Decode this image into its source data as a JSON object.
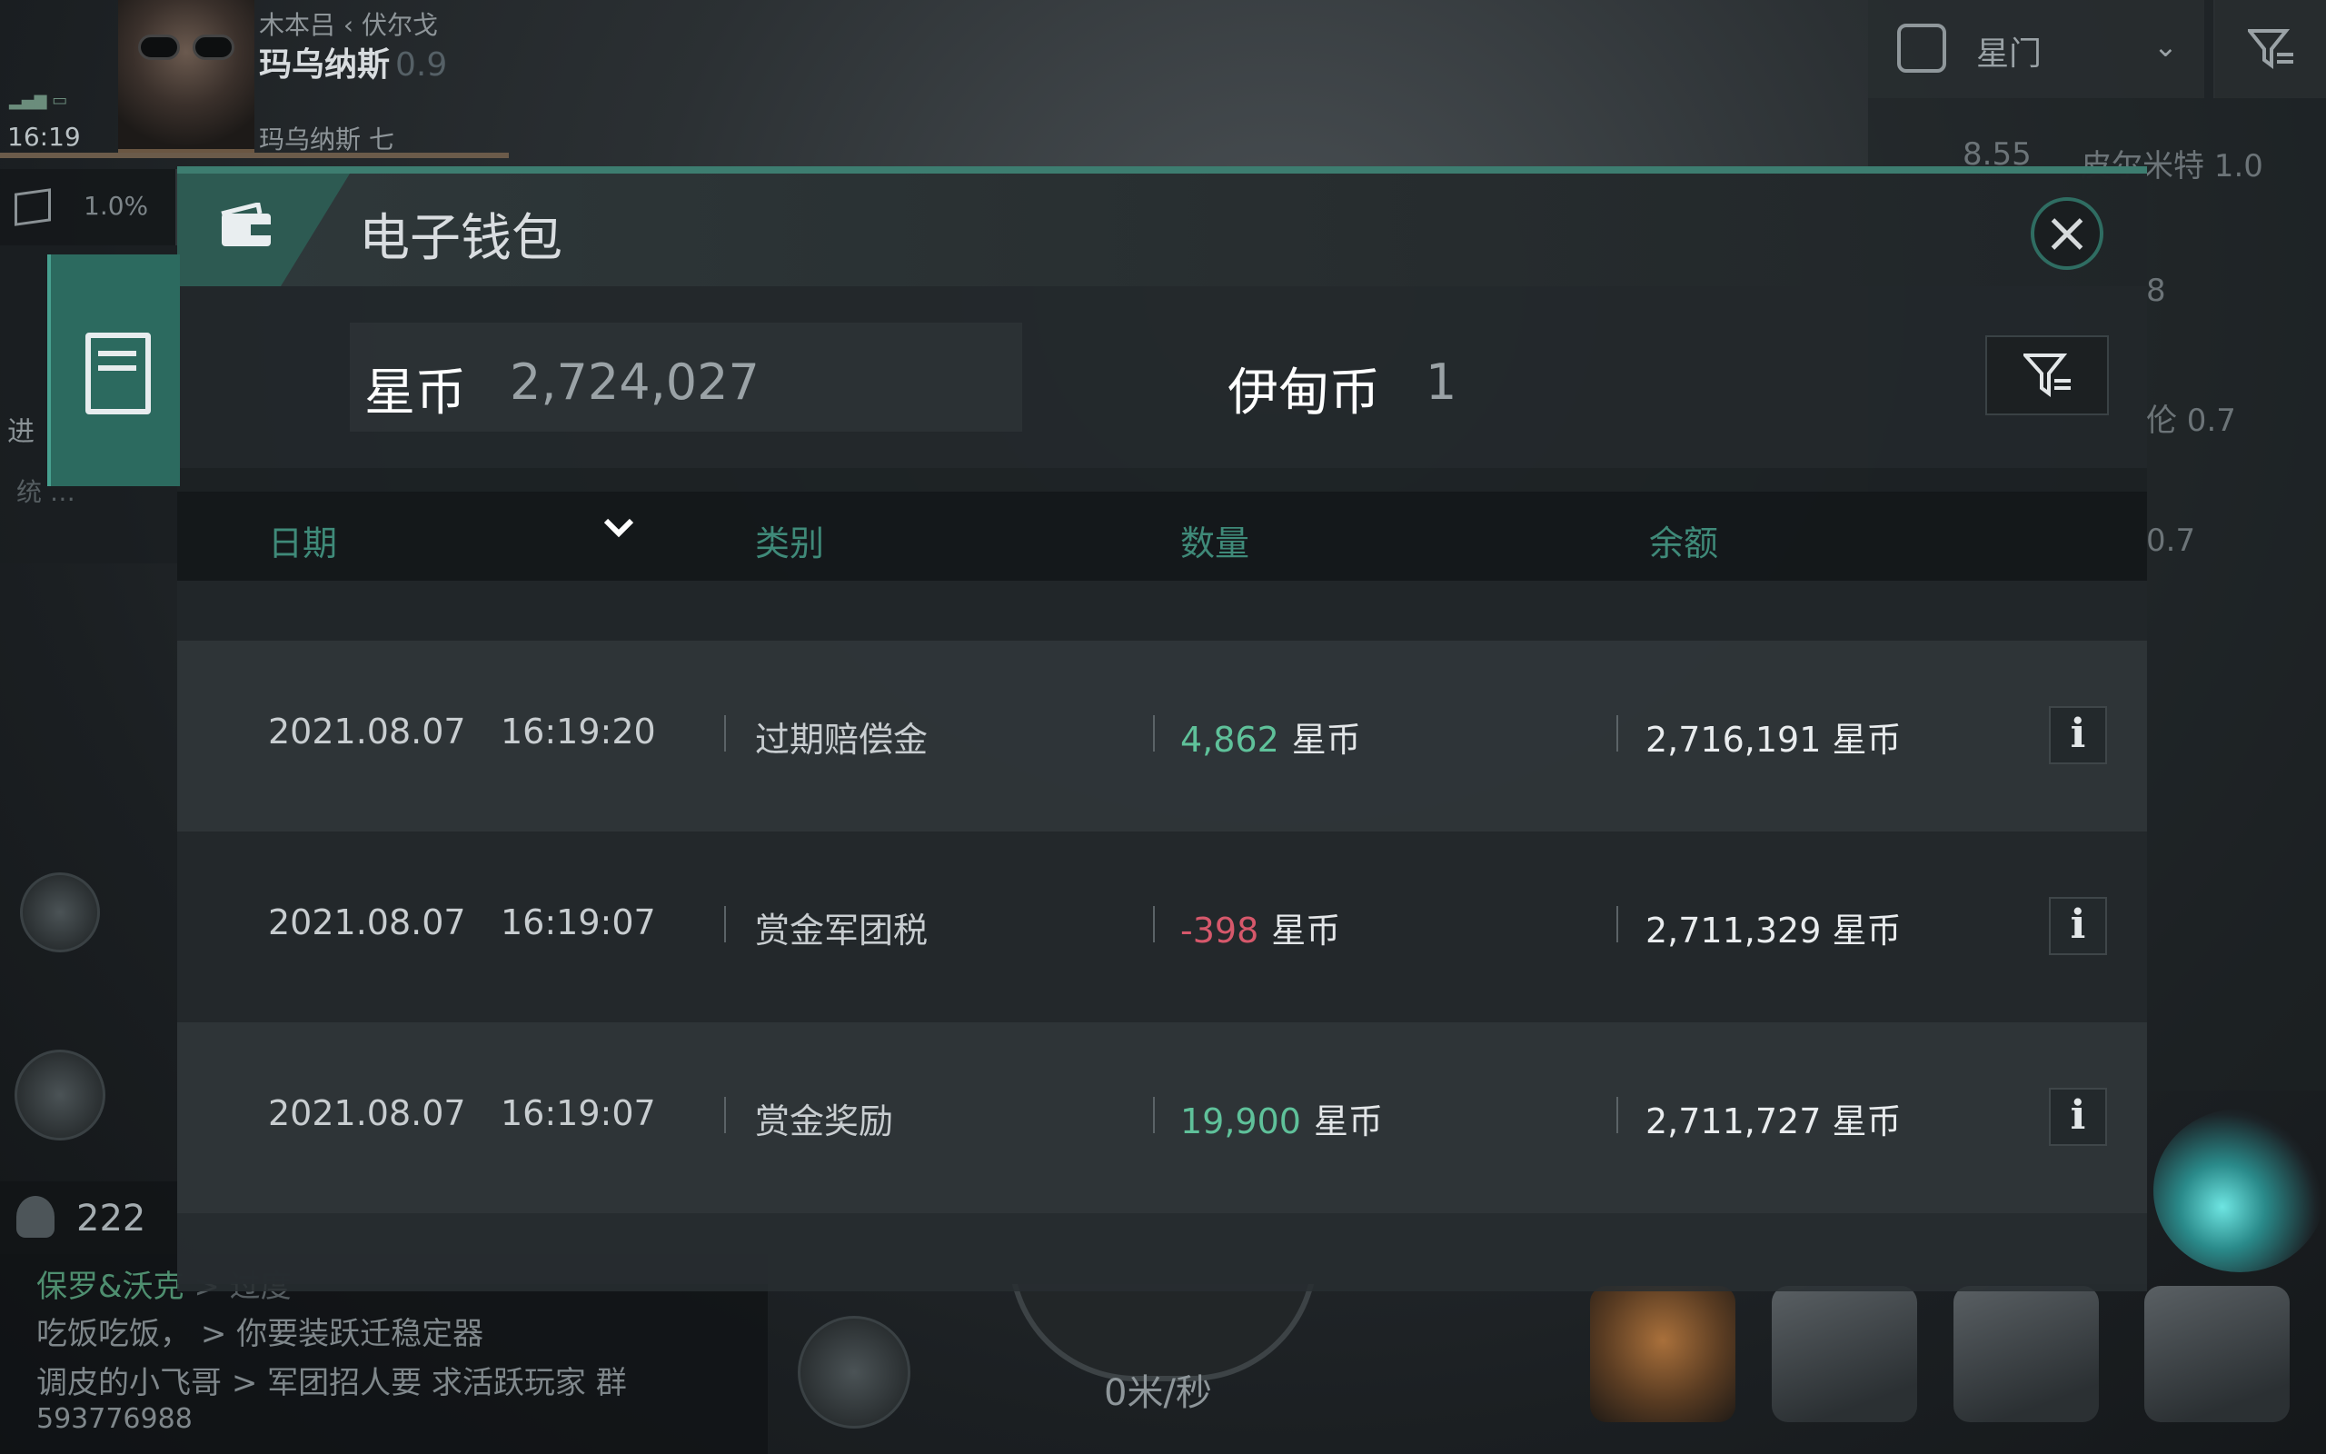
{
  "hud": {
    "time": "16:19",
    "route": "木本吕 ‹ 伏尔戈",
    "system": "玛乌纳斯",
    "security": "0.9",
    "station": "玛乌纳斯 七",
    "cargo_pct": "1.0%",
    "side_text_1": "进",
    "side_text_2": "统 …",
    "gate_label": "星门",
    "right_rows": [
      "8.55",
      "皮尔米特 1.0",
      "8",
      "伦 0.7",
      "0.7"
    ],
    "local_count": "222",
    "speed": "0米/秒"
  },
  "chat": {
    "lines": [
      {
        "name": "保罗&沃克",
        "text": "> 过度"
      },
      {
        "name": "吃饭吃饭，",
        "text": "> 你要装跃迁稳定器"
      },
      {
        "name": "调皮的小飞哥",
        "text": "> 军团招人要 求活跃玩家 群"
      },
      {
        "name": "",
        "text": "593776988"
      }
    ]
  },
  "wallet": {
    "title": "电子钱包",
    "star_coin_label": "星币",
    "star_coin_value": "2,724,027",
    "eden_coin_label": "伊甸币",
    "eden_coin_value": "1",
    "columns": {
      "date": "日期",
      "category": "类别",
      "amount": "数量",
      "balance": "余额"
    },
    "rows": [
      {
        "date": "2021.08.07",
        "time": "16:19:20",
        "category": "过期赔偿金",
        "amount": "4,862",
        "amount_unit": "星币",
        "sign": "pos",
        "balance": "2,716,191 星币"
      },
      {
        "date": "2021.08.07",
        "time": "16:19:07",
        "category": "赏金军团税",
        "amount": "-398",
        "amount_unit": "星币",
        "sign": "neg",
        "balance": "2,711,329 星币"
      },
      {
        "date": "2021.08.07",
        "time": "16:19:07",
        "category": "赏金奖励",
        "amount": "19,900",
        "amount_unit": "星币",
        "sign": "pos",
        "balance": "2,711,727 星币"
      }
    ],
    "info_glyph": "i",
    "colors": {
      "accent": "#2c6a5f",
      "positive": "#5fc19a",
      "negative": "#d6586b",
      "header_text": "#3f8a79"
    }
  }
}
